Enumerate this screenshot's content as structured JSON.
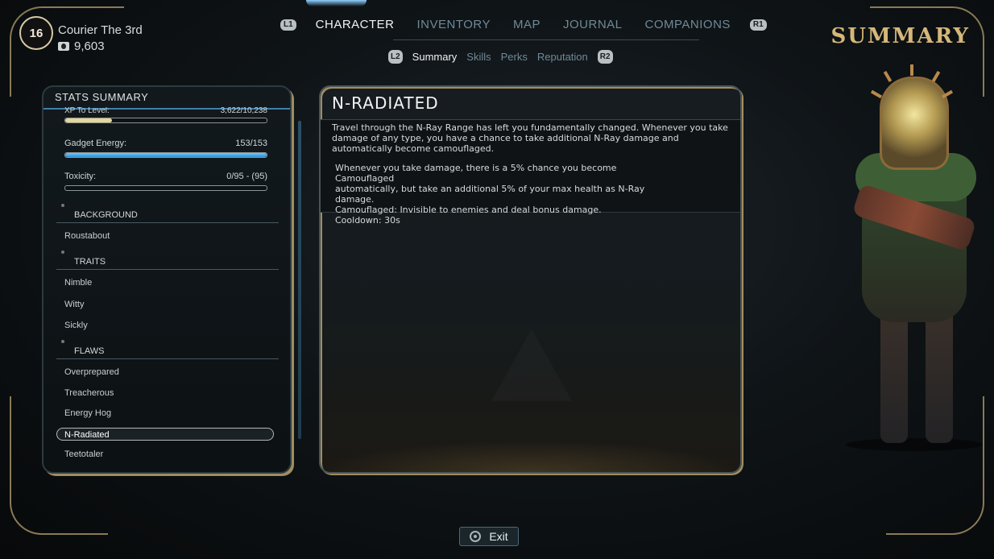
{
  "player": {
    "level": "16",
    "name": "Courier The 3rd",
    "currency": "9,603"
  },
  "nav": {
    "left_hint": "L1",
    "right_hint": "R1",
    "tabs": [
      "CHARACTER",
      "INVENTORY",
      "MAP",
      "JOURNAL",
      "COMPANIONS"
    ],
    "active_tab": "CHARACTER"
  },
  "subnav": {
    "left_hint": "L2",
    "right_hint": "R2",
    "tabs": [
      "Summary",
      "Skills",
      "Perks",
      "Reputation"
    ],
    "active_tab": "Summary"
  },
  "page_title": "SUMMARY",
  "stats_panel": {
    "title": "STATS SUMMARY",
    "xp_label": "XP To Level:",
    "xp_value": "3,622/10,238",
    "xp_fill": 0.23,
    "gadget_label": "Gadget Energy:",
    "gadget_value": "153/153",
    "gadget_fill": 1.0,
    "toxicity_label": "Toxicity:",
    "toxicity_value": "0/95 - (95)",
    "toxicity_fill": 0.0,
    "background_header": "BACKGROUND",
    "background_value": "Roustabout",
    "traits_header": "TRAITS",
    "traits": [
      "Nimble",
      "Witty",
      "Sickly"
    ],
    "flaws_header": "FLAWS",
    "flaws": [
      "Overprepared",
      "Treacherous",
      "Energy Hog",
      "N-Radiated",
      "Teetotaler"
    ],
    "selected_flaw": "N-Radiated"
  },
  "detail": {
    "title": "N-RADIATED",
    "description": "Travel through the N-Ray Range has left you fundamentally changed. Whenever you take damage of any type, you have a chance to take additional N-Ray damage and automatically become camouflaged.",
    "effect_lines": [
      "Whenever you take damage, there is a 5% chance you become Camouflaged",
      "automatically, but take an additional 5% of your max health as N-Ray damage.",
      "Camouflaged: Invisible to enemies and deal bonus damage.",
      "Cooldown: 30s"
    ]
  },
  "footer": {
    "exit_label": "Exit"
  },
  "colors": {
    "accent_blue": "#3f9fd8",
    "xp_yellow": "#e3d79a",
    "gold": "#d5b77a"
  }
}
